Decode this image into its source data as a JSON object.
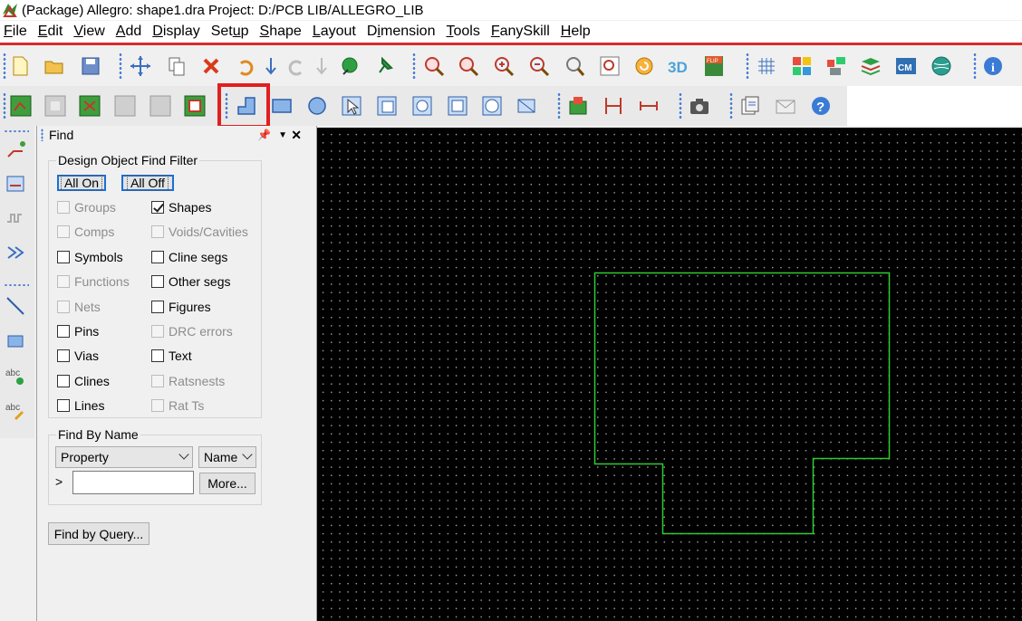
{
  "window": {
    "title": "(Package) Allegro: shape1.dra  Project: D:/PCB LIB/ALLEGRO_LIB"
  },
  "menu": [
    {
      "label": "File",
      "u": "F"
    },
    {
      "label": "Edit",
      "u": "E"
    },
    {
      "label": "View",
      "u": "V"
    },
    {
      "label": "Add",
      "u": "A"
    },
    {
      "label": "Display",
      "u": "D"
    },
    {
      "label": "Setup",
      "u": "u"
    },
    {
      "label": "Shape",
      "u": "S"
    },
    {
      "label": "Layout",
      "u": "L"
    },
    {
      "label": "Dimension",
      "u": "i"
    },
    {
      "label": "Tools",
      "u": "T"
    },
    {
      "label": "FanySkill",
      "u": "F"
    },
    {
      "label": "Help",
      "u": "H"
    }
  ],
  "panel": {
    "title": "Find",
    "filter_group_title": "Design Object Find Filter",
    "all_on": "All On",
    "all_off": "All Off",
    "checkboxes": [
      {
        "label": "Groups",
        "checked": false,
        "enabled": false
      },
      {
        "label": "Shapes",
        "checked": true,
        "enabled": true
      },
      {
        "label": "Comps",
        "checked": false,
        "enabled": false
      },
      {
        "label": "Voids/Cavities",
        "checked": false,
        "enabled": false
      },
      {
        "label": "Symbols",
        "checked": false,
        "enabled": true
      },
      {
        "label": "Cline segs",
        "checked": false,
        "enabled": true
      },
      {
        "label": "Functions",
        "checked": false,
        "enabled": false
      },
      {
        "label": "Other segs",
        "checked": false,
        "enabled": true
      },
      {
        "label": "Nets",
        "checked": false,
        "enabled": false
      },
      {
        "label": "Figures",
        "checked": false,
        "enabled": true
      },
      {
        "label": "Pins",
        "checked": false,
        "enabled": true
      },
      {
        "label": "DRC errors",
        "checked": false,
        "enabled": false
      },
      {
        "label": "Vias",
        "checked": false,
        "enabled": true
      },
      {
        "label": "Text",
        "checked": false,
        "enabled": true
      },
      {
        "label": "Clines",
        "checked": false,
        "enabled": true
      },
      {
        "label": "Ratsnests",
        "checked": false,
        "enabled": false
      },
      {
        "label": "Lines",
        "checked": false,
        "enabled": true
      },
      {
        "label": "Rat Ts",
        "checked": false,
        "enabled": false
      }
    ],
    "find_by_name_title": "Find By Name",
    "property_select": "Property",
    "name_select": "Name",
    "prompt_symbol": ">",
    "name_input_value": "",
    "more_button": "More...",
    "find_by_query_button": "Find by Query..."
  },
  "colors": {
    "menu_underline": "#d92b2b",
    "shape_outline": "#2ecc2e",
    "highlight_box": "#e02020",
    "canvas_bg": "#000000"
  },
  "icons": {
    "toolbar1": [
      "new-file-icon",
      "open-folder-icon",
      "save-icon",
      "move-icon",
      "copy-icon",
      "delete-icon",
      "undo-icon",
      "arrow-down-icon",
      "redo-icon",
      "arrow-down-gray-icon",
      "green-pick-icon",
      "pin-icon",
      "zoom-fit-icon",
      "zoom-points-icon",
      "zoom-in-icon",
      "zoom-out-icon",
      "zoom-previous-icon",
      "zoom-world-icon",
      "refresh-icon",
      "3d-view-icon",
      "flip-icon",
      "grid-icon",
      "color-icon",
      "layer-visibility-icon",
      "stack-icon",
      "cm-icon",
      "globe-icon",
      "info-icon"
    ],
    "toolbar2": [
      "shape-add-icon",
      "shape-void-icon",
      "shape-edit-icon",
      "shape-gray-icon",
      "shape-gray2-icon",
      "shape-boundary-icon",
      "shape-add-rect-notch-icon",
      "shape-add-rect-icon",
      "shape-add-circle-icon",
      "select-shape-icon",
      "manual-void-icon",
      "void-circle-icon",
      "void-rect-icon",
      "void-element-icon",
      "merge-shapes-icon",
      "place-component-icon",
      "dimension-icon",
      "dimension2-icon",
      "camera-icon",
      "export-icon",
      "mail-icon",
      "help-icon"
    ],
    "leftstrip": [
      "route-icon",
      "slide-icon",
      "delay-tune-icon",
      "fanout-icon",
      "line-tool-icon",
      "rect-tool-icon",
      "add-text-icon",
      "edit-text-icon"
    ]
  }
}
